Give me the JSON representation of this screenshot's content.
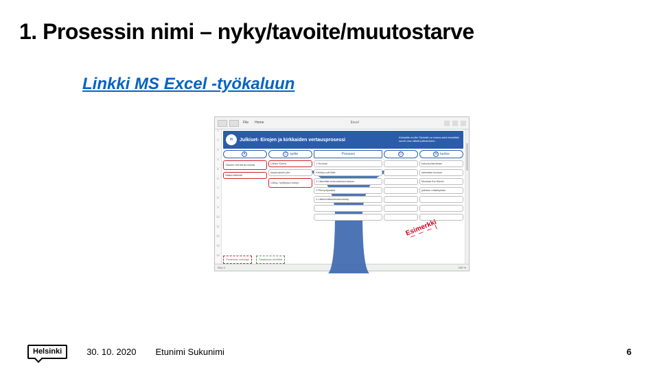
{
  "slide": {
    "title": "1. Prosessin nimi – nyky/tavoite/muutostarve",
    "link_text": "Linkki MS Excel -työkaluun",
    "excel": {
      "window_title": "Excel",
      "banner_title": "Julkiset- Eirojen ja kirkkaiden vertausprosessi",
      "banner_side": "Kirkkaille eroille Tärkeää on hakea sekä keskittää suurin osa näistä julkiskoiden...",
      "logo": "H",
      "col_headers": {
        "a": {
          "letter": "A",
          "label": ""
        },
        "c": {
          "letter": "C",
          "label": "syöte"
        },
        "proc": {
          "label": "Prosessi"
        },
        "d": {
          "letter": "D",
          "label": ""
        },
        "r": {
          "letter": "R",
          "label": "tuotos"
        }
      },
      "colA": [
        "Tärkein Kehitä terveestä",
        "Säännöllisellä"
      ],
      "colC": [
        "Lähes Sorea",
        "kysymykset yös",
        "Läksy, hyötyoppi kumpi"
      ],
      "colProc": [
        "1 Kuvaus",
        "Kehitys pdf ikää",
        "2 Lähettää keskustelukohtainen",
        "3 Pienyritysaika",
        "4 Lähimmäiskohtaisuuskäy"
      ],
      "colD": [
        "",
        "",
        "",
        "",
        ""
      ],
      "colR": [
        "kuluuko/tarvitaan",
        "sairaalan kuvaus",
        "Moniala Esi Moniö",
        "julkisen määrityksiin"
      ],
      "footer_cells": [
        "Prosessin omistaja",
        "Staakkaan kehittää"
      ],
      "stamp": "Esimerkki",
      "statusbar_left": "Sivu 1",
      "statusbar_right": "100 %"
    },
    "footer": {
      "logo": "Helsinki",
      "date": "30. 10. 2020",
      "author": "Etunimi Sukunimi",
      "page": "6"
    }
  }
}
